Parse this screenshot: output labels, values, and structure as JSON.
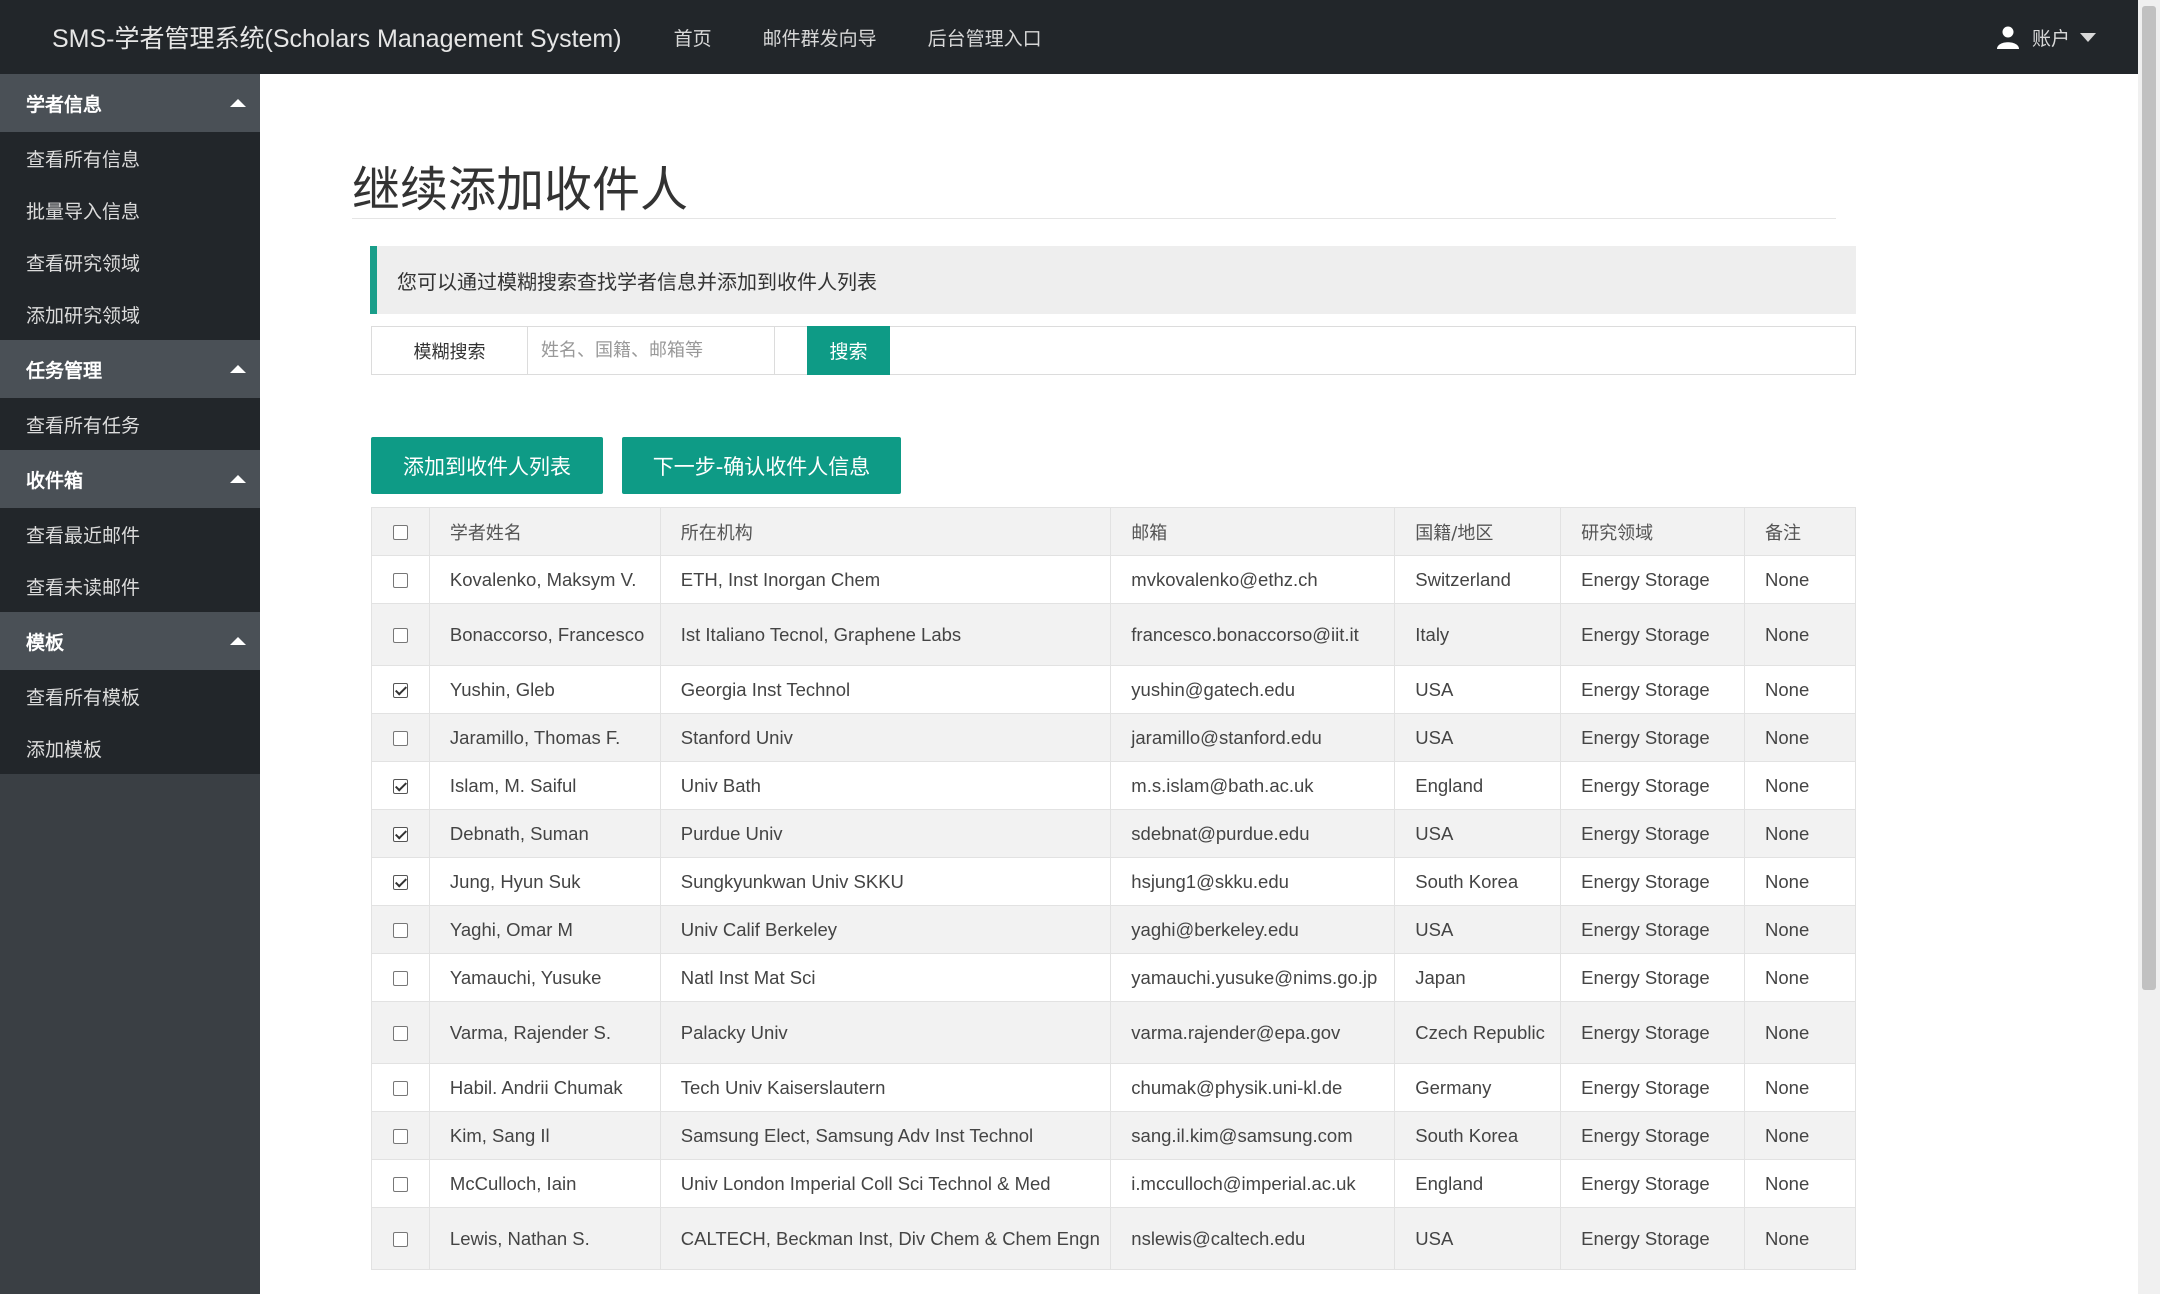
{
  "navbar": {
    "brand": "SMS-学者管理系统(Scholars Management System)",
    "links": [
      "首页",
      "邮件群发向导",
      "后台管理入口"
    ],
    "account_label": "账户"
  },
  "sidebar": {
    "groups": [
      {
        "label": "学者信息",
        "items": [
          "查看所有信息",
          "批量导入信息",
          "查看研究领域",
          "添加研究领域"
        ]
      },
      {
        "label": "任务管理",
        "items": [
          "查看所有任务"
        ]
      },
      {
        "label": "收件箱",
        "items": [
          "查看最近邮件",
          "查看未读邮件"
        ]
      },
      {
        "label": "模板",
        "items": [
          "查看所有模板",
          "添加模板"
        ]
      }
    ]
  },
  "page": {
    "title": "继续添加收件人",
    "callout": "您可以通过模糊搜索查找学者信息并添加到收件人列表"
  },
  "search": {
    "label": "模糊搜索",
    "placeholder": "姓名、国籍、邮箱等",
    "value": "",
    "button": "搜索"
  },
  "actions": {
    "add_label": "添加到收件人列表",
    "next_label": "下一步-确认收件人信息"
  },
  "table": {
    "headers": [
      "学者姓名",
      "所在机构",
      "邮箱",
      "国籍/地区",
      "研究领域",
      "备注"
    ],
    "rows": [
      {
        "checked": false,
        "name": "Kovalenko, Maksym V.",
        "org": "ETH, Inst Inorgan Chem",
        "email": "mvkovalenko@ethz.ch",
        "country": "Switzerland",
        "field": "Energy Storage",
        "note": "None"
      },
      {
        "checked": false,
        "name": "Bonaccorso, Francesco",
        "org": "Ist Italiano Tecnol, Graphene Labs",
        "email": "francesco.bonaccorso@iit.it",
        "country": "Italy",
        "field": "Energy Storage",
        "note": "None"
      },
      {
        "checked": true,
        "name": "Yushin, Gleb",
        "org": "Georgia Inst Technol",
        "email": "yushin@gatech.edu",
        "country": "USA",
        "field": "Energy Storage",
        "note": "None"
      },
      {
        "checked": false,
        "name": "Jaramillo, Thomas F.",
        "org": "Stanford Univ",
        "email": "jaramillo@stanford.edu",
        "country": "USA",
        "field": "Energy Storage",
        "note": "None"
      },
      {
        "checked": true,
        "name": "Islam, M. Saiful",
        "org": "Univ Bath",
        "email": "m.s.islam@bath.ac.uk",
        "country": "England",
        "field": "Energy Storage",
        "note": "None"
      },
      {
        "checked": true,
        "name": "Debnath, Suman",
        "org": "Purdue Univ",
        "email": "sdebnat@purdue.edu",
        "country": "USA",
        "field": "Energy Storage",
        "note": "None"
      },
      {
        "checked": true,
        "name": "Jung, Hyun Suk",
        "org": "Sungkyunkwan Univ SKKU",
        "email": "hsjung1@skku.edu",
        "country": "South Korea",
        "field": "Energy Storage",
        "note": "None"
      },
      {
        "checked": false,
        "name": "Yaghi, Omar M",
        "org": "Univ Calif Berkeley",
        "email": "yaghi@berkeley.edu",
        "country": "USA",
        "field": "Energy Storage",
        "note": "None"
      },
      {
        "checked": false,
        "name": "Yamauchi, Yusuke",
        "org": "Natl Inst Mat Sci",
        "email": "yamauchi.yusuke@nims.go.jp",
        "country": "Japan",
        "field": "Energy Storage",
        "note": "None"
      },
      {
        "checked": false,
        "name": "Varma, Rajender S.",
        "org": "Palacky Univ",
        "email": "varma.rajender@epa.gov",
        "country": "Czech Republic",
        "field": "Energy Storage",
        "note": "None"
      },
      {
        "checked": false,
        "name": "Habil. Andrii Chumak",
        "org": "Tech Univ Kaiserslautern",
        "email": "chumak@physik.uni-kl.de",
        "country": "Germany",
        "field": "Energy Storage",
        "note": "None"
      },
      {
        "checked": false,
        "name": "Kim, Sang Il",
        "org": "Samsung Elect, Samsung Adv Inst Technol",
        "email": "sang.il.kim@samsung.com",
        "country": "South Korea",
        "field": "Energy Storage",
        "note": "None"
      },
      {
        "checked": false,
        "name": "McCulloch, Iain",
        "org": "Univ London Imperial Coll Sci Technol & Med",
        "email": "i.mcculloch@imperial.ac.uk",
        "country": "England",
        "field": "Energy Storage",
        "note": "None"
      },
      {
        "checked": false,
        "name": "Lewis, Nathan S.",
        "org": "CALTECH, Beckman Inst, Div Chem & Chem Engn",
        "email": "nslewis@caltech.edu",
        "country": "USA",
        "field": "Energy Storage",
        "note": "None"
      }
    ]
  },
  "colors": {
    "primary": "#0e9b86",
    "navbar": "#22262a",
    "sidebar_group": "#4a5056"
  }
}
